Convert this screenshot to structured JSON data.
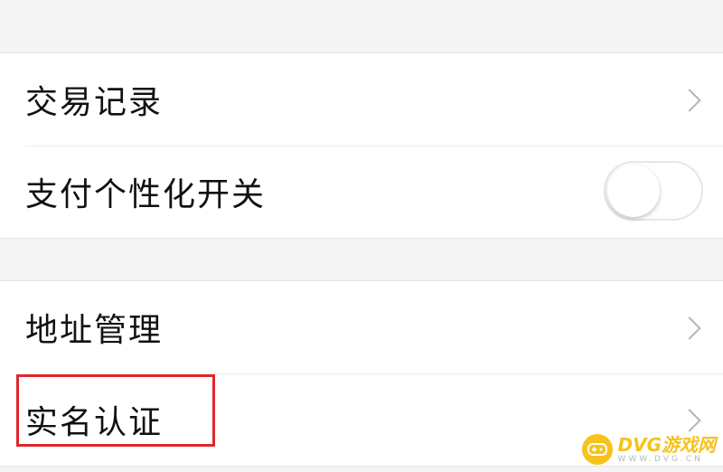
{
  "section1": {
    "items": [
      {
        "label": "交易记录",
        "control": "chevron",
        "icon": "chevron-right-icon"
      },
      {
        "label": "支付个性化开关",
        "control": "toggle",
        "toggle_state": "off"
      }
    ]
  },
  "section2": {
    "items": [
      {
        "label": "地址管理",
        "control": "chevron",
        "icon": "chevron-right-icon"
      },
      {
        "label": "实名认证",
        "control": "chevron",
        "icon": "chevron-right-icon",
        "highlighted": true
      }
    ]
  },
  "highlight": {
    "color": "#e0262c",
    "target": "实名认证"
  },
  "watermark": {
    "title": "DVG游戏网",
    "subtitle": "WWW.DVG.CN",
    "logo": "gamepad-icon",
    "color": "#f6c21c"
  },
  "colors": {
    "background": "#f4f4f4",
    "row_background": "#ffffff",
    "text": "#111111",
    "chevron": "#b5b5b5"
  }
}
